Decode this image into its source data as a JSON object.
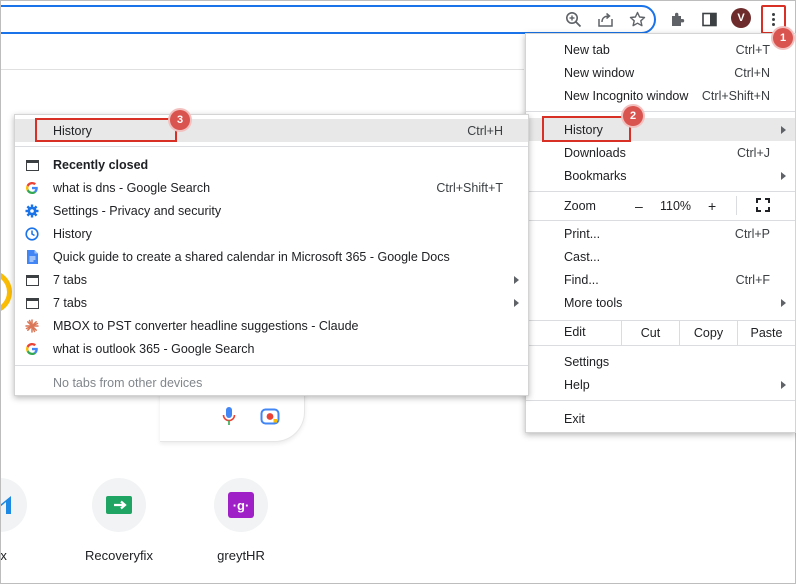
{
  "toolbar": {
    "avatar_letter": "V",
    "icons": [
      "zoom-icon",
      "share-icon",
      "star-icon",
      "extensions-icon",
      "side-panel-icon",
      "menu-kebab-icon"
    ]
  },
  "badges": {
    "one": "1",
    "two": "2",
    "three": "3"
  },
  "main_menu": {
    "new_tab": {
      "label": "New tab",
      "shortcut": "Ctrl+T"
    },
    "new_window": {
      "label": "New window",
      "shortcut": "Ctrl+N"
    },
    "incognito": {
      "label": "New Incognito window",
      "shortcut": "Ctrl+Shift+N"
    },
    "history": {
      "label": "History"
    },
    "downloads": {
      "label": "Downloads",
      "shortcut": "Ctrl+J"
    },
    "bookmarks": {
      "label": "Bookmarks"
    },
    "zoom": {
      "label": "Zoom",
      "minus": "–",
      "value": "110%",
      "plus": "+"
    },
    "print": {
      "label": "Print...",
      "shortcut": "Ctrl+P"
    },
    "cast": {
      "label": "Cast..."
    },
    "find": {
      "label": "Find...",
      "shortcut": "Ctrl+F"
    },
    "more_tools": {
      "label": "More tools"
    },
    "edit": {
      "label": "Edit",
      "cut": "Cut",
      "copy": "Copy",
      "paste": "Paste"
    },
    "settings": {
      "label": "Settings"
    },
    "help": {
      "label": "Help"
    },
    "exit": {
      "label": "Exit"
    }
  },
  "history_menu": {
    "history": {
      "label": "History",
      "shortcut": "Ctrl+H"
    },
    "recently_closed": "Recently closed",
    "items": [
      {
        "label": "what is dns - Google Search",
        "shortcut": "Ctrl+Shift+T",
        "icon": "google-icon"
      },
      {
        "label": "Settings - Privacy and security",
        "icon": "settings-gear-icon"
      },
      {
        "label": "History",
        "icon": "history-clock-icon"
      },
      {
        "label": "Quick guide to create a shared calendar in Microsoft 365 - Google Docs",
        "icon": "google-docs-icon"
      },
      {
        "label": "7 tabs",
        "icon": "tab-window-icon",
        "submenu": true
      },
      {
        "label": "7 tabs",
        "icon": "tab-window-icon",
        "submenu": true
      },
      {
        "label": "MBOX to PST converter headline suggestions - Claude",
        "icon": "claude-icon"
      },
      {
        "label": "what is outlook 365 - Google Search",
        "icon": "google-icon"
      }
    ],
    "no_tabs": "No tabs from other devices"
  },
  "shortcuts": [
    {
      "label": "ox"
    },
    {
      "label": "Recoveryfix"
    },
    {
      "label": "greytHR"
    }
  ],
  "colors": {
    "accent": "#1a73e8",
    "callout": "#d93025",
    "badge": "#d9534f",
    "recoveryfix": "#1fa463",
    "greythr": "#a020c8"
  }
}
